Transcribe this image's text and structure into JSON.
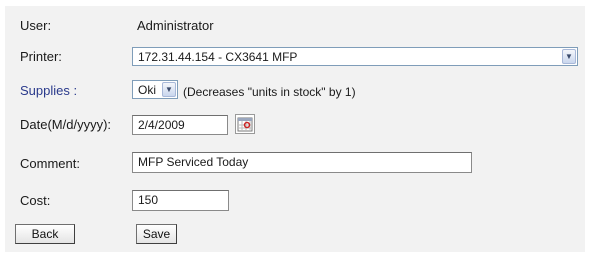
{
  "form": {
    "user": {
      "label": "User:",
      "value": "Administrator"
    },
    "printer": {
      "label": "Printer:",
      "selected": "172.31.44.154 - CX3641 MFP"
    },
    "supplies": {
      "label": "Supplies :",
      "selected": "Oki",
      "note": "(Decreases \"units in stock\" by 1)"
    },
    "date": {
      "label": "Date(M/d/yyyy):",
      "value": "2/4/2009"
    },
    "comment": {
      "label": "Comment:",
      "value": "MFP Serviced Today"
    },
    "cost": {
      "label": "Cost:",
      "value": "150"
    },
    "buttons": {
      "back": "Back",
      "save": "Save"
    }
  },
  "icons": {
    "dropdown": "chevron-down-icon",
    "calendar": "calendar-icon"
  }
}
